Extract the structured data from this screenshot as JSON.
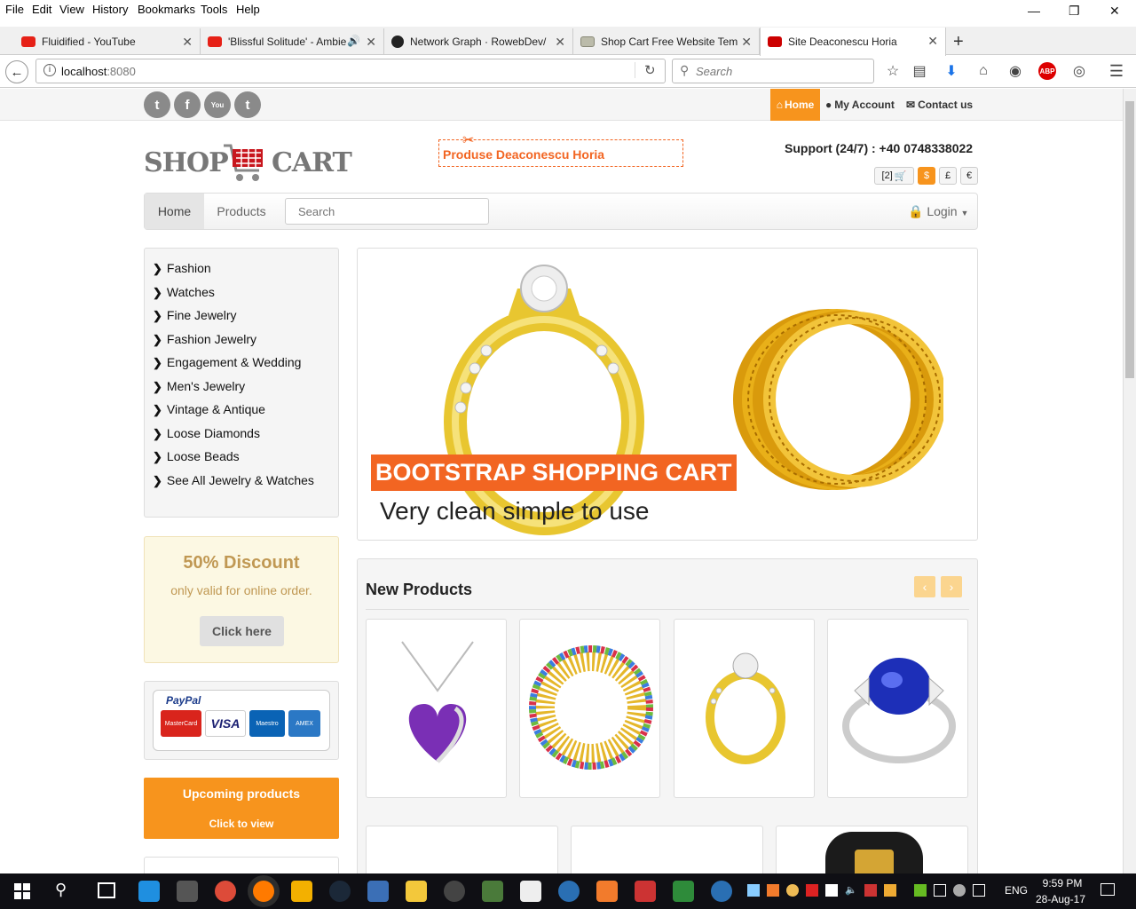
{
  "menu": [
    "File",
    "Edit",
    "View",
    "History",
    "Bookmarks",
    "Tools",
    "Help"
  ],
  "tabs": [
    {
      "title": "Fluidified - YouTube"
    },
    {
      "title": "'Blissful Solitude' - Ambie"
    },
    {
      "title": "Network Graph · RowebDev/"
    },
    {
      "title": "Shop Cart Free Website Tem"
    },
    {
      "title": "Site Deaconescu Horia"
    }
  ],
  "url": {
    "host": "localhost",
    "port": ":8080"
  },
  "search_placeholder": "Search",
  "top_nav": {
    "home": "Home",
    "account": "My Account",
    "contact": "Contact us"
  },
  "logo": {
    "left": "SHOP",
    "right": "CART"
  },
  "banner_label": "Produse Deaconescu Horia",
  "support": "Support (24/7) : +40 0748338022",
  "cart_count": "[2]",
  "currencies": [
    "$",
    "£",
    "€"
  ],
  "main_nav": {
    "home": "Home",
    "products": "Products",
    "search_placeholder": "Search",
    "login": "Login"
  },
  "categories": [
    "Fashion",
    "Watches",
    "Fine Jewelry",
    "Fashion Jewelry",
    "Engagement & Wedding",
    "Men's Jewelry",
    "Vintage & Antique",
    "Loose Diamonds",
    "Loose Beads",
    "See All Jewelry & Watches"
  ],
  "discount": {
    "title": "50% Discount",
    "subtitle": "only valid for online order.",
    "button": "Click here"
  },
  "paypal": {
    "label": "PayPal",
    "cards": [
      "MasterCard",
      "VISA",
      "Maestro",
      "AMEX"
    ]
  },
  "upcoming": {
    "title": "Upcoming products",
    "subtitle": "Click to view"
  },
  "hero": {
    "title": "BOOTSTRAP SHOPPING CART",
    "subtitle": "Very clean simple to use"
  },
  "new_products": {
    "title": "New Products"
  },
  "taskbar": {
    "time": "9:59 PM",
    "date": "28-Aug-17",
    "lang": "ENG"
  },
  "colors": {
    "orange": "#f7941d",
    "accent": "#f26522",
    "discount_bg": "#fcf8e3"
  }
}
